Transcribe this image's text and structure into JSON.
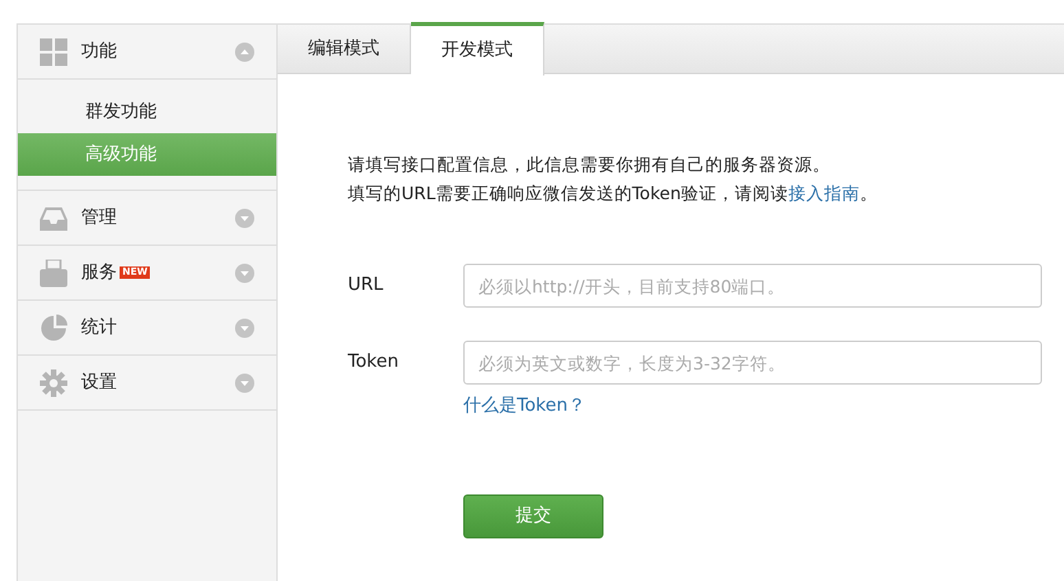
{
  "sidebar": {
    "sections": [
      {
        "label": "功能",
        "expanded": true,
        "children": [
          {
            "label": "群发功能",
            "selected": false
          },
          {
            "label": "高级功能",
            "selected": true
          }
        ]
      },
      {
        "label": "管理",
        "expanded": false
      },
      {
        "label": "服务",
        "badge": "NEW",
        "expanded": false
      },
      {
        "label": "统计",
        "expanded": false
      },
      {
        "label": "设置",
        "expanded": false
      }
    ]
  },
  "tabs": [
    {
      "label": "编辑模式",
      "selected": false
    },
    {
      "label": "开发模式",
      "selected": true
    }
  ],
  "intro": {
    "line_1": "请填写接口配置信息，此信息需要你拥有自己的服务器资源。",
    "line_2": {
      "text": "填写的URL需要正确响应微信发送的Token验证，请阅读",
      "link": "接入指南",
      "after": "。"
    }
  },
  "form": {
    "fields": [
      {
        "label": "URL",
        "placeholder": "必须以http://开头，目前支持80端口。"
      },
      {
        "label": "Token",
        "placeholder": "必须为英文或数字，长度为3-32字符。",
        "help_link": "什么是Token？"
      }
    ],
    "submit": "提交"
  }
}
